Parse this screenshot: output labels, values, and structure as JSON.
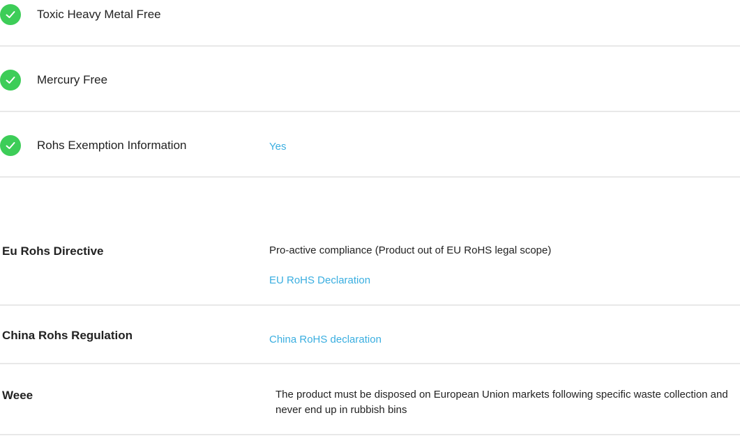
{
  "features": [
    {
      "label": "Toxic Heavy Metal Free",
      "value": ""
    },
    {
      "label": "Mercury Free",
      "value": ""
    },
    {
      "label": "Rohs Exemption Information",
      "value": "Yes"
    }
  ],
  "regulations": {
    "eu_rohs": {
      "label": "Eu Rohs Directive",
      "text": "Pro-active compliance (Product out of EU RoHS legal scope)",
      "link": "EU RoHS Declaration"
    },
    "china_rohs": {
      "label": "China Rohs Regulation",
      "link": "China RoHS declaration"
    },
    "weee": {
      "label": "Weee",
      "text": "The product must be disposed on European Union markets following specific waste collection and never end up in rubbish bins"
    }
  },
  "colors": {
    "check": "#3dcd58",
    "link": "#3aaee0",
    "divider": "#e8e8e8"
  },
  "icons": {
    "feature_status": "check-circle-icon"
  }
}
